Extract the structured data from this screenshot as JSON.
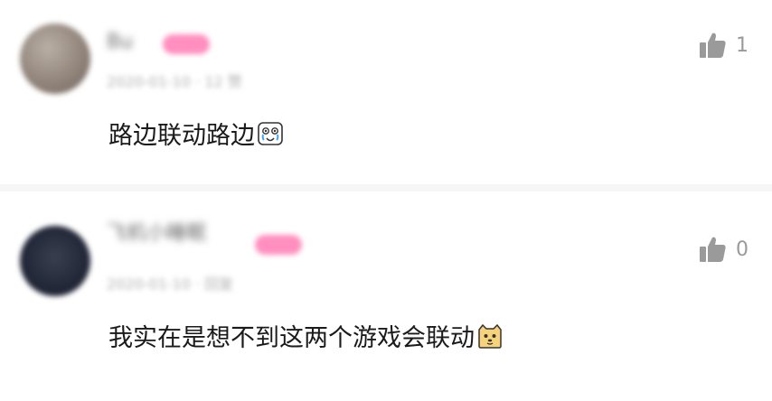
{
  "comments": [
    {
      "username": "Bu",
      "meta": "2020-01-10 · 12 赞",
      "likes": "1",
      "text": "路边联动路边",
      "emoji": "crying-laughing-sticker-icon",
      "avatar_color": "#9b8e84"
    },
    {
      "username": "飞机小睡眠",
      "meta": "2020-01-10 · 回复",
      "likes": "0",
      "text": "我实在是想不到这两个游戏会联动",
      "emoji": "cat-face-sticker-icon",
      "avatar_color": "#24293a"
    }
  ],
  "colors": {
    "badge": "#ff8fbf",
    "like_icon": "#9a9a9a",
    "text": "#1a1a1a",
    "divider": "#f6f6f6"
  }
}
